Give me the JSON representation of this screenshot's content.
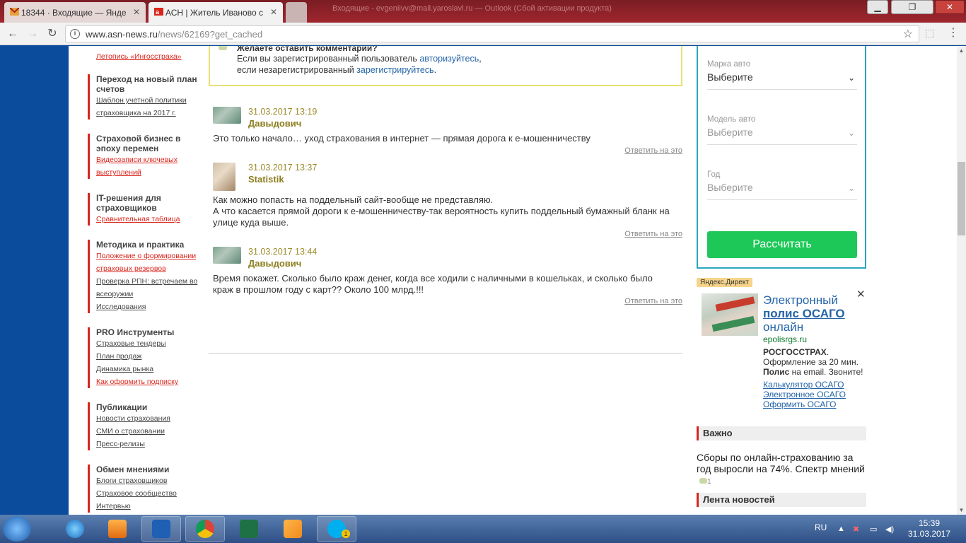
{
  "browser": {
    "tabs": [
      {
        "label": "18344 · Входящие — Янде",
        "active": false
      },
      {
        "label": "АСН | Житель Иваново с",
        "active": true
      }
    ],
    "background_window_title": "Входящие - evgeniivv@mail.yaroslavl.ru — Outlook (Сбой активации продукта)",
    "url_host": "www.asn-news.ru",
    "url_path": "/news/62169?get_cached"
  },
  "sidebar": {
    "top_link": "Летопись «Ингосстраха»",
    "groups": [
      {
        "title": "Переход на новый план счетов",
        "links": [
          {
            "text": "Шаблон учетной политики страховщика на 2017 г.",
            "red": false
          }
        ]
      },
      {
        "title": "Страховой бизнес в эпоху перемен",
        "links": [
          {
            "text": "Видеозаписи ключевых выступлений",
            "red": true
          }
        ]
      },
      {
        "title": "IT-решения для страховщиков",
        "links": [
          {
            "text": "Сравнительная таблица",
            "red": true
          }
        ]
      },
      {
        "title": "Методика и практика",
        "links": [
          {
            "text": "Положение о формировании страховых резервов",
            "red": true
          },
          {
            "text": "Проверка РПН: встречаем во всеоружии",
            "red": false
          },
          {
            "text": "Исследования",
            "red": false
          }
        ]
      },
      {
        "title": "PRO Инструменты",
        "links": [
          {
            "text": "Страховые тендеры",
            "red": false
          },
          {
            "text": "План продаж",
            "red": false
          },
          {
            "text": "Динамика рынка",
            "red": false
          },
          {
            "text": "Как оформить подписку",
            "red": true
          }
        ]
      },
      {
        "title": "Публикации",
        "links": [
          {
            "text": "Новости страхования",
            "red": false
          },
          {
            "text": "СМИ о страховании",
            "red": false
          },
          {
            "text": "Пресс-релизы",
            "red": false
          }
        ]
      },
      {
        "title": "Обмен мнениями",
        "links": [
          {
            "text": "Блоги страховщиков",
            "red": false
          },
          {
            "text": "Страховое сообщество",
            "red": false
          },
          {
            "text": "Интервью",
            "red": false
          }
        ]
      }
    ]
  },
  "comment_cta": {
    "title": "Желаете оставить комментарий?",
    "line1_pre": "Если вы зарегистрированный пользователь ",
    "line1_link": "авторизуйтесь",
    "line1_post": ",",
    "line2_pre": "если незарегистрированный ",
    "line2_link": "зарегистрируйтесь",
    "line2_post": "."
  },
  "comments": [
    {
      "date": "31.03.2017 13:19",
      "author": "Давыдович",
      "text": "Это только начало… уход страхования в интернет — прямая дорога к е-мошенничеству",
      "reply": "Ответить на это"
    },
    {
      "date": "31.03.2017 13:37",
      "author": "Statistik",
      "text": "Как можно попасть на поддельный сайт-вообще не представляю.\nА что касается прямой дороги к е-мошенничеству-так вероятность купить поддельный бумажный бланк на улице куда выше.",
      "reply": "Ответить на это"
    },
    {
      "date": "31.03.2017 13:44",
      "author": "Давыдович",
      "text": "Время покажет. Сколько было краж денег, когда все ходили с наличными в кошельках, и сколько было краж в прошлом году с карт?? Около 100 млрд.!!!",
      "reply": "Ответить на это"
    }
  ],
  "calculator": {
    "fields": [
      {
        "label": "Марка авто",
        "value": "Выберите",
        "enabled": true
      },
      {
        "label": "Модель авто",
        "value": "Выберите",
        "enabled": false
      },
      {
        "label": "Год",
        "value": "Выберите",
        "enabled": false
      }
    ],
    "button": "Рассчитать"
  },
  "ad": {
    "badge": "Яндекс.Директ",
    "title_pre": "Электронный ",
    "title_bold": "полис ОСАГО",
    "title_post": " онлайн",
    "domain": "epolisrgs.ru",
    "desc_brand": "РОСГОССТРАХ",
    "desc_brand_post": ".",
    "desc_line2": "Оформление за 20 мин.",
    "desc_bold": "Полис",
    "desc_line3_post": " на email. Звоните!",
    "links": [
      "Калькулятор ОСАГО",
      "Электронное ОСАГО",
      "Оформить ОСАГО"
    ]
  },
  "important": {
    "heading": "Важно",
    "news_text": "Сборы по онлайн-страхованию за год выросли на 74%. Спектр мнений",
    "news_count": "1"
  },
  "news_feed": {
    "heading": "Лента новостей"
  },
  "taskbar": {
    "lang": "RU",
    "time": "15:39",
    "date": "31.03.2017",
    "skype_badge": "1"
  }
}
